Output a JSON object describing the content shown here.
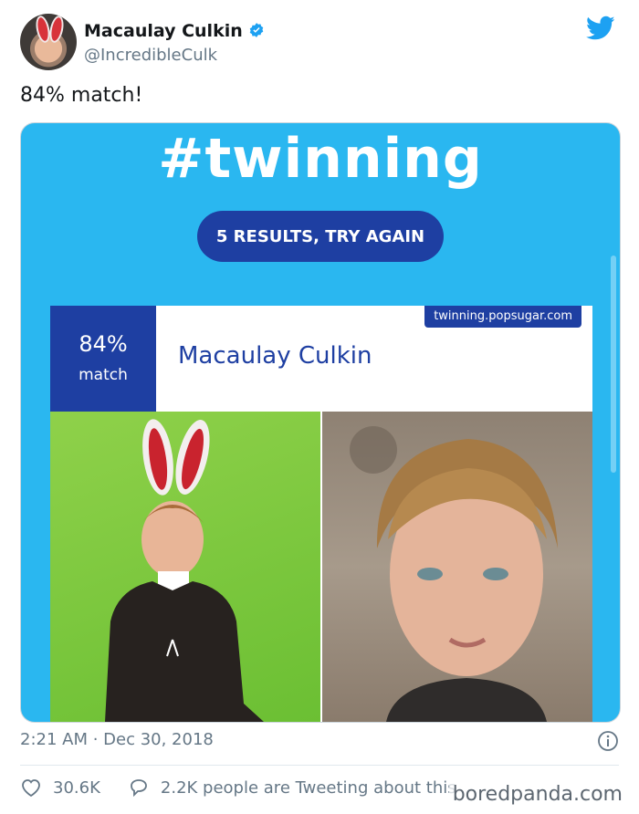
{
  "user": {
    "name": "Macaulay Culkin",
    "handle": "@IncredibleCulk"
  },
  "tweet": {
    "text": "84% match!"
  },
  "media": {
    "hashtag": "#twinning",
    "button_label": "5 RESULTS, TRY AGAIN",
    "card": {
      "match_percent": "84%",
      "match_word": "match",
      "name": "Macaulay Culkin",
      "source": "twinning.popsugar.com"
    }
  },
  "meta": {
    "timestamp": "2:21 AM · Dec 30, 2018"
  },
  "footer": {
    "likes": "30.6K",
    "conversation": "2.2K people are Tweeting about this"
  },
  "watermark": "boredpanda.com",
  "colors": {
    "twitter_blue": "#1da1f2",
    "card_blue": "#1e3fa2",
    "media_bg": "#2ab7f0"
  },
  "icons": [
    "verified-badge-icon",
    "twitter-bird-icon",
    "info-icon",
    "heart-icon",
    "reply-bubble-icon"
  ]
}
